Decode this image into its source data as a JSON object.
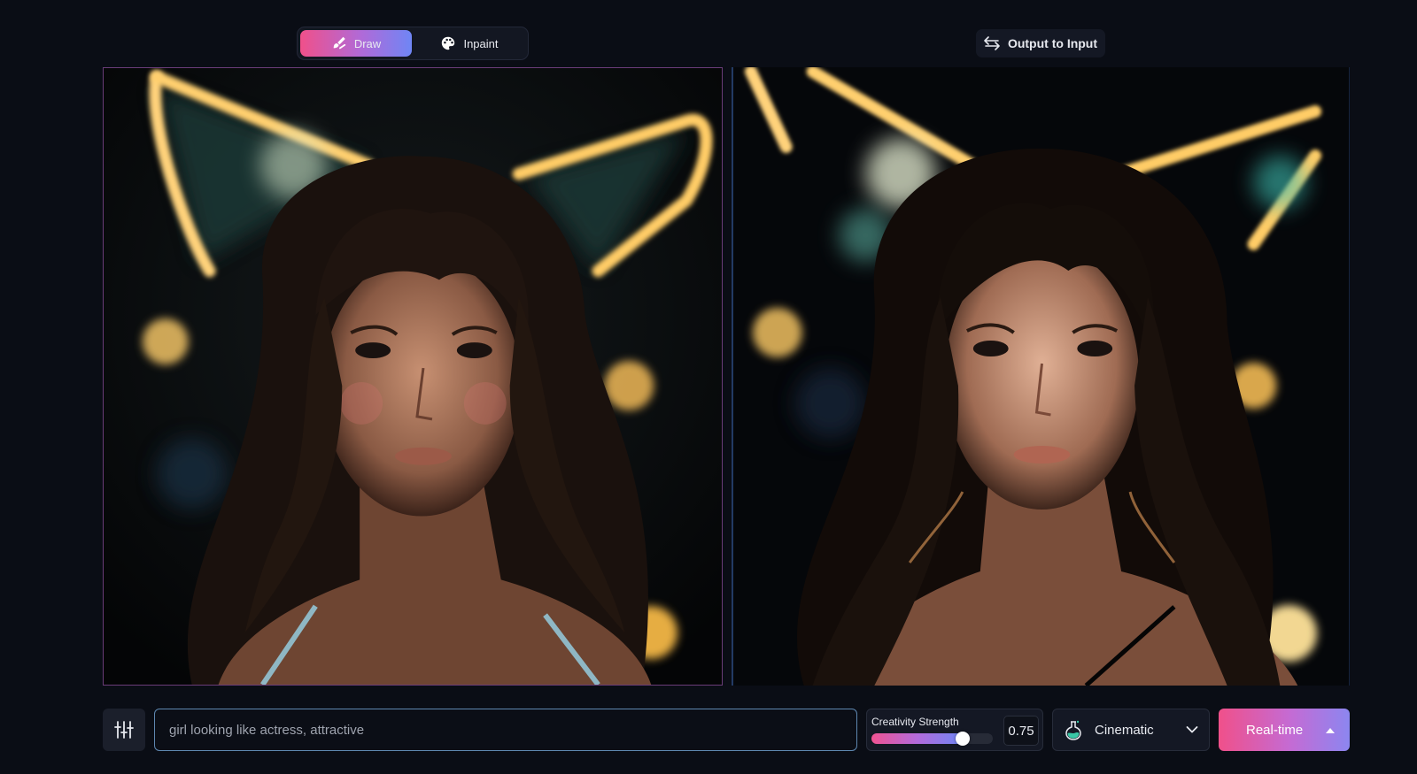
{
  "toolbar": {
    "modes": [
      {
        "label": "Draw",
        "icon": "brush-icon",
        "active": true
      },
      {
        "label": "Inpaint",
        "icon": "palette-icon",
        "active": false
      }
    ],
    "output_to_input_label": "Output to Input"
  },
  "canvases": {
    "input_icon": "input-image",
    "output_icon": "output-image"
  },
  "prompt": {
    "value": "girl looking like actress, attractive",
    "placeholder": ""
  },
  "creativity": {
    "label": "Creativity Strength",
    "value": "0.75",
    "level": 0.75
  },
  "style": {
    "label": "Cinematic",
    "icon": "potion-icon"
  },
  "generate": {
    "label": "Real-time",
    "icon": "caret-up-icon"
  },
  "colors": {
    "accent_gradient": [
      "#f0508a",
      "#b06ad8",
      "#6f86f5"
    ],
    "background": "#0a0d15",
    "prompt_border": "#5e87b0"
  }
}
